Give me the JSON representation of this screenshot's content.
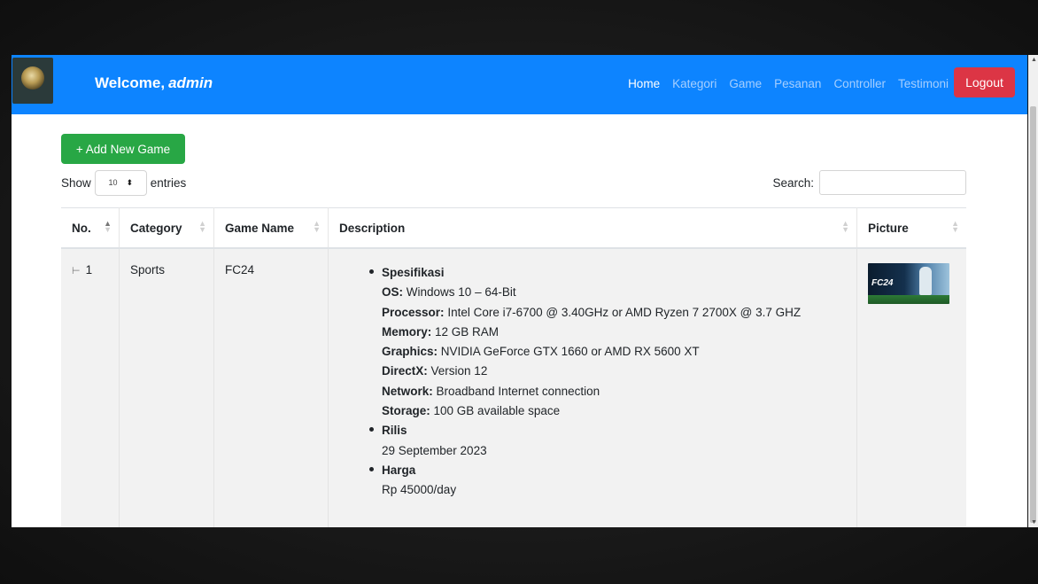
{
  "navbar": {
    "welcome_prefix": "Welcome,",
    "username": "admin",
    "links": [
      "Home",
      "Kategori",
      "Game",
      "Pesanan",
      "Controller",
      "Testimoni"
    ],
    "active_link": "Home",
    "logout_label": "Logout",
    "brand_color": "#0d84ff"
  },
  "toolbar": {
    "add_label": "+ Add New Game",
    "show_label": "Show",
    "entries_value": "10",
    "entries_label": "entries",
    "search_label": "Search:"
  },
  "table": {
    "columns": [
      "No.",
      "Category",
      "Game Name",
      "Description",
      "Picture"
    ],
    "rows": [
      {
        "no": "1",
        "category": "Sports",
        "game_name": "FC24",
        "picture_text": "FC24",
        "description": {
          "spec_title": "Spesifikasi",
          "specs": [
            {
              "label": "OS:",
              "value": "Windows 10 – 64-Bit"
            },
            {
              "label": "Processor:",
              "value": "Intel Core i7-6700 @ 3.40GHz or AMD Ryzen 7 2700X @ 3.7 GHZ"
            },
            {
              "label": "Memory:",
              "value": "12 GB RAM"
            },
            {
              "label": "Graphics:",
              "value": "NVIDIA GeForce GTX 1660 or AMD RX 5600 XT"
            },
            {
              "label": "DirectX:",
              "value": "Version 12"
            },
            {
              "label": "Network:",
              "value": "Broadband Internet connection"
            },
            {
              "label": "Storage:",
              "value": "100 GB available space"
            }
          ],
          "rilis_title": "Rilis",
          "rilis_value": "29 September 2023",
          "harga_title": "Harga",
          "harga_value": "Rp 45000/day"
        }
      }
    ]
  },
  "colors": {
    "add_button": "#28a745",
    "logout_button": "#dc3545"
  }
}
